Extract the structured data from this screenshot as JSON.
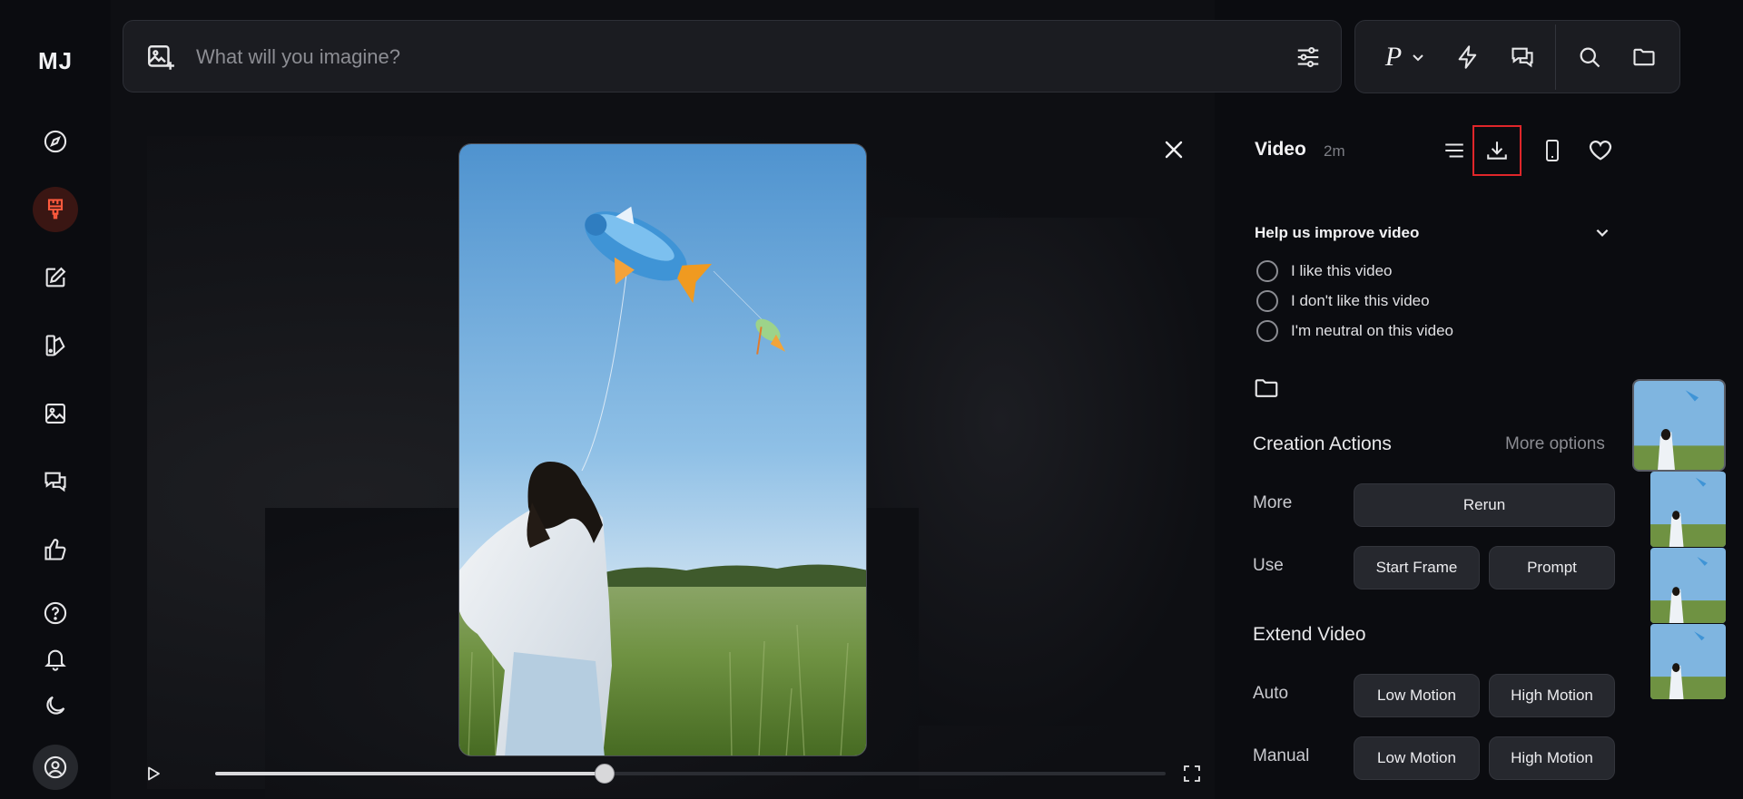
{
  "sidebar": {
    "logo": "MJ",
    "items": [
      {
        "name": "explore",
        "icon": "compass-icon"
      },
      {
        "name": "create",
        "icon": "paintbrush-icon",
        "active": true
      },
      {
        "name": "edit",
        "icon": "pencil-edit-icon"
      },
      {
        "name": "personalize",
        "icon": "palette-book-icon"
      },
      {
        "name": "organize",
        "icon": "image-icon"
      },
      {
        "name": "chat",
        "icon": "chat-bubbles-icon"
      },
      {
        "name": "tasks",
        "icon": "thumbs-up-icon"
      },
      {
        "name": "help",
        "icon": "question-icon"
      },
      {
        "name": "updates",
        "icon": "bell-icon"
      },
      {
        "name": "theme",
        "icon": "moon-icon"
      },
      {
        "name": "account",
        "icon": "user-circle-icon"
      }
    ]
  },
  "prompt": {
    "placeholder": "What will you imagine?"
  },
  "toolbar": {
    "personalize_label": "P"
  },
  "viewer": {
    "progress": 0.41
  },
  "panel": {
    "title": "Video",
    "age": "2m",
    "feedback": {
      "title": "Help us improve video",
      "options": [
        "I like this video",
        "I don't like this video",
        "I'm neutral on this video"
      ]
    },
    "creation": {
      "title": "Creation Actions",
      "more_options": "More options",
      "more_label": "More",
      "rerun": "Rerun",
      "use_label": "Use",
      "start_frame": "Start Frame",
      "prompt": "Prompt"
    },
    "extend": {
      "title": "Extend Video",
      "auto_label": "Auto",
      "manual_label": "Manual",
      "low_motion": "Low Motion",
      "high_motion": "High Motion"
    }
  },
  "colors": {
    "accent": "#e0262a",
    "active_bg": "#3a1613"
  }
}
